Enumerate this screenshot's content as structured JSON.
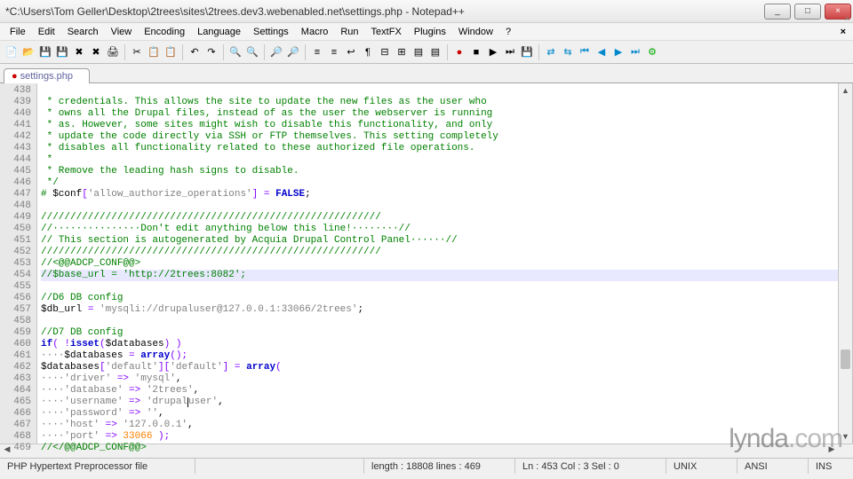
{
  "window": {
    "title": "*C:\\Users\\Tom Geller\\Desktop\\2trees\\sites\\2trees.dev3.webenabled.net\\settings.php - Notepad++",
    "min": "_",
    "max": "□",
    "close": "×"
  },
  "menu": [
    "File",
    "Edit",
    "Search",
    "View",
    "Encoding",
    "Language",
    "Settings",
    "Macro",
    "Run",
    "TextFX",
    "Plugins",
    "Window",
    "?"
  ],
  "tab": {
    "label": "settings.php"
  },
  "gutter_start": 438,
  "gutter_count": 32,
  "closebox": "×",
  "code": {
    "l438": " * credentials. This allows the site to update the new files as the user who",
    "l439": " * owns all the Drupal files, instead of as the user the webserver is running",
    "l440": " * as. However, some sites might wish to disable this functionality, and only",
    "l441": " * update the code directly via SSH or FTP themselves. This setting completely",
    "l442": " * disables all functionality related to these authorized file operations.",
    "l443": " *",
    "l444": " * Remove the leading hash signs to disable.",
    "l445": " */",
    "l446a": "# ",
    "l446b": "$conf",
    "l446c": "[",
    "l446d": "'allow_authorize_operations'",
    "l446e": "]",
    "l446f": " = ",
    "l446g": "FALSE",
    "l446h": ";",
    "l448": "//////////////////////////////////////////////////////////",
    "l449": "//···············Don't edit anything below this line!········//",
    "l450": "// This section is autogenerated by Acquia Drupal Control Panel······//",
    "l451": "//////////////////////////////////////////////////////////",
    "l452": "//<@@ADCP_CONF@@>",
    "l453": "//$base_url = 'http://2trees:8082';",
    "l455": "//D6 DB config",
    "l456a": "$db_url",
    "l456b": " = ",
    "l456c": "'mysqli://drupaluser@127.0.0.1:33066/2trees'",
    "l456d": ";",
    "l458": "//D7 DB config",
    "l459a": "if",
    "l459b": "( !",
    "l459c": "isset",
    "l459d": "(",
    "l459e": "$databases",
    "l459f": ") )",
    "l460a": "····",
    "l460b": "$databases",
    "l460c": " = ",
    "l460d": "array",
    "l460e": "();",
    "l461a": "$databases",
    "l461b": "[",
    "l461c": "'default'",
    "l461d": "][",
    "l461e": "'default'",
    "l461f": "]",
    "l461g": " = ",
    "l461h": "array",
    "l461i": "(",
    "l462a": "····",
    "l462b": "'driver'",
    "l462c": " => ",
    "l462d": "'mysql'",
    "l462e": ",",
    "l463a": "····",
    "l463b": "'database'",
    "l463c": " => ",
    "l463d": "'2trees'",
    "l463e": ",",
    "l464a": "····",
    "l464b": "'username'",
    "l464c": " => ",
    "l464d_pre": "'drupal",
    "l464d_post": "user'",
    "l464e": ",",
    "l465a": "····",
    "l465b": "'password'",
    "l465c": " => ",
    "l465d": "''",
    "l465e": ",",
    "l466a": "····",
    "l466b": "'host'",
    "l466c": " => ",
    "l466d": "'127.0.0.1'",
    "l466e": ",",
    "l467a": "····",
    "l467b": "'port'",
    "l467c": " => ",
    "l467d": "33066",
    "l467e": " );",
    "l468": "//</@@ADCP_CONF@@>"
  },
  "status": {
    "filetype": "PHP Hypertext Preprocessor file",
    "length": "length : 18808    lines : 469",
    "pos": "Ln : 453    Col : 3    Sel : 0",
    "eol": "UNIX",
    "enc": "ANSI",
    "mode": "INS"
  },
  "watermark": {
    "a": "lynda",
    "b": ".com"
  }
}
